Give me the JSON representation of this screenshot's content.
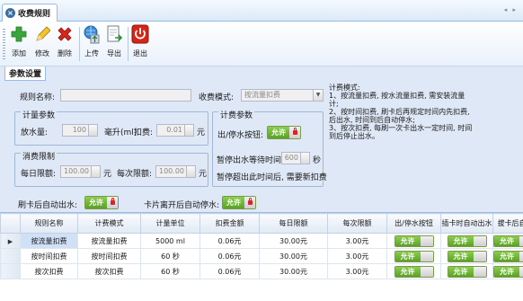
{
  "tab": {
    "title": "收费规则",
    "scroll_arrows": "◂ ▸"
  },
  "toolbar": {
    "add": "添加",
    "edit": "修改",
    "delete": "删除",
    "upload": "上传",
    "export": "导出",
    "exit": "退出"
  },
  "panel": {
    "title": "参数设置",
    "rule_name_label": "规则名称:",
    "rule_name_value": "",
    "mode_label": "收费模式:",
    "mode_value": "按流量扣费",
    "metering": {
      "legend": "计量参数",
      "water_label": "放水量:",
      "water_value": "100",
      "water_unit": "毫升(ml)",
      "deduct_label": "扣费:",
      "deduct_value": "0.01",
      "deduct_unit": "元"
    },
    "limit": {
      "legend": "消费限制",
      "daily_label": "每日限额:",
      "daily_value": "100.00",
      "daily_unit": "元",
      "each_label": "每次限额:",
      "each_value": "100.00",
      "each_unit": "元"
    },
    "timing": {
      "legend": "计费参数",
      "stop_label": "出/停水按钮:",
      "stop_toggle": "允许",
      "wait_label": "暂停出水等待时间:",
      "wait_value": "600",
      "wait_unit": "秒",
      "wait_note": "暂停超出此时间后, 需要新扣费"
    },
    "swipe_auto_label": "刷卡后自动出水:",
    "swipe_auto_toggle": "允许",
    "leave_stop_label": "卡片离开后自动停水:",
    "leave_stop_toggle": "允许",
    "help_text": "计费模式:\n1、按流量扣费, 按水流量扣费, 需安装流量计;\n2、按时间扣费, 刷卡后再规定时间内先扣费, 后出水, 时间到后自动停水;\n3、按次扣费, 每刷一次卡出水一定时间, 时间到后停止出水。"
  },
  "grid": {
    "columns": [
      "规则名称",
      "计费模式",
      "计量单位",
      "扣费金额",
      "每日限额",
      "每次限额",
      "出/停水按钮",
      "插卡时自动出水",
      "拔卡后自"
    ],
    "rows": [
      {
        "name": "按流量扣费",
        "mode": "按流量扣费",
        "unit": "5000 ml",
        "fee": "0.06元",
        "daily": "30.00元",
        "each": "3.00元",
        "t1": "允许",
        "t2": "允许",
        "t3": "允许"
      },
      {
        "name": "按时间扣费",
        "mode": "按时间扣费",
        "unit": "60 秒",
        "fee": "0.06元",
        "daily": "30.00元",
        "each": "3.00元",
        "t1": "允许",
        "t2": "允许",
        "t3": "允许"
      },
      {
        "name": "按次扣费",
        "mode": "按次扣费",
        "unit": "60 秒",
        "fee": "0.06元",
        "daily": "30.00元",
        "each": "3.00元",
        "t1": "允许",
        "t2": "允许",
        "t3": "允许"
      }
    ],
    "row_pointer": "▶"
  },
  "colors": {
    "toggle_on": "#5aa127",
    "accent": "#99bbe8",
    "panel_bg": "#dfe8f6"
  }
}
